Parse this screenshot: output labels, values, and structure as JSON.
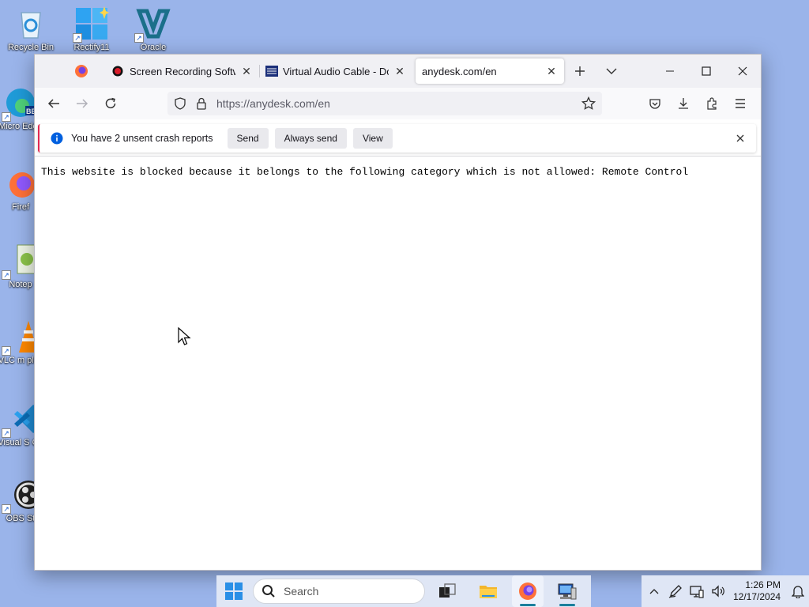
{
  "desktop": {
    "icons": [
      {
        "label": "Recycle Bin",
        "icon": "recycle-bin-icon"
      },
      {
        "label": "Rectify11",
        "icon": "rectify11-icon"
      },
      {
        "label": "Oracle",
        "icon": "virtualbox-icon"
      },
      {
        "label": "Micro Edge",
        "icon": "edge-icon"
      },
      {
        "label": "Firef",
        "icon": "firefox-icon"
      },
      {
        "label": "Notep",
        "icon": "notepad-icon"
      },
      {
        "label": "VLC m play",
        "icon": "vlc-icon"
      },
      {
        "label": "Visual S Co",
        "icon": "vscode-icon"
      },
      {
        "label": "OBS St",
        "icon": "obs-icon"
      }
    ]
  },
  "browser": {
    "tabs": [
      {
        "title": "Screen Recording Software",
        "icon": "record-icon"
      },
      {
        "title": "Virtual Audio Cable - Download",
        "icon": "vac-icon"
      },
      {
        "title": "anydesk.com/en",
        "active": true
      }
    ],
    "url": "https://anydesk.com/en",
    "notification": {
      "message": "You have 2 unsent crash reports",
      "buttons": [
        "Send",
        "Always send",
        "View"
      ]
    },
    "page_text": "This website is blocked because it belongs to the following category which is not allowed: Remote Control"
  },
  "taskbar": {
    "search_label": "Search",
    "time": "1:26 PM",
    "date": "12/17/2024"
  },
  "colors": {
    "desktop_bg": "#9ab4ea",
    "notif_accent": "#e22850",
    "info_blue": "#0060df"
  }
}
